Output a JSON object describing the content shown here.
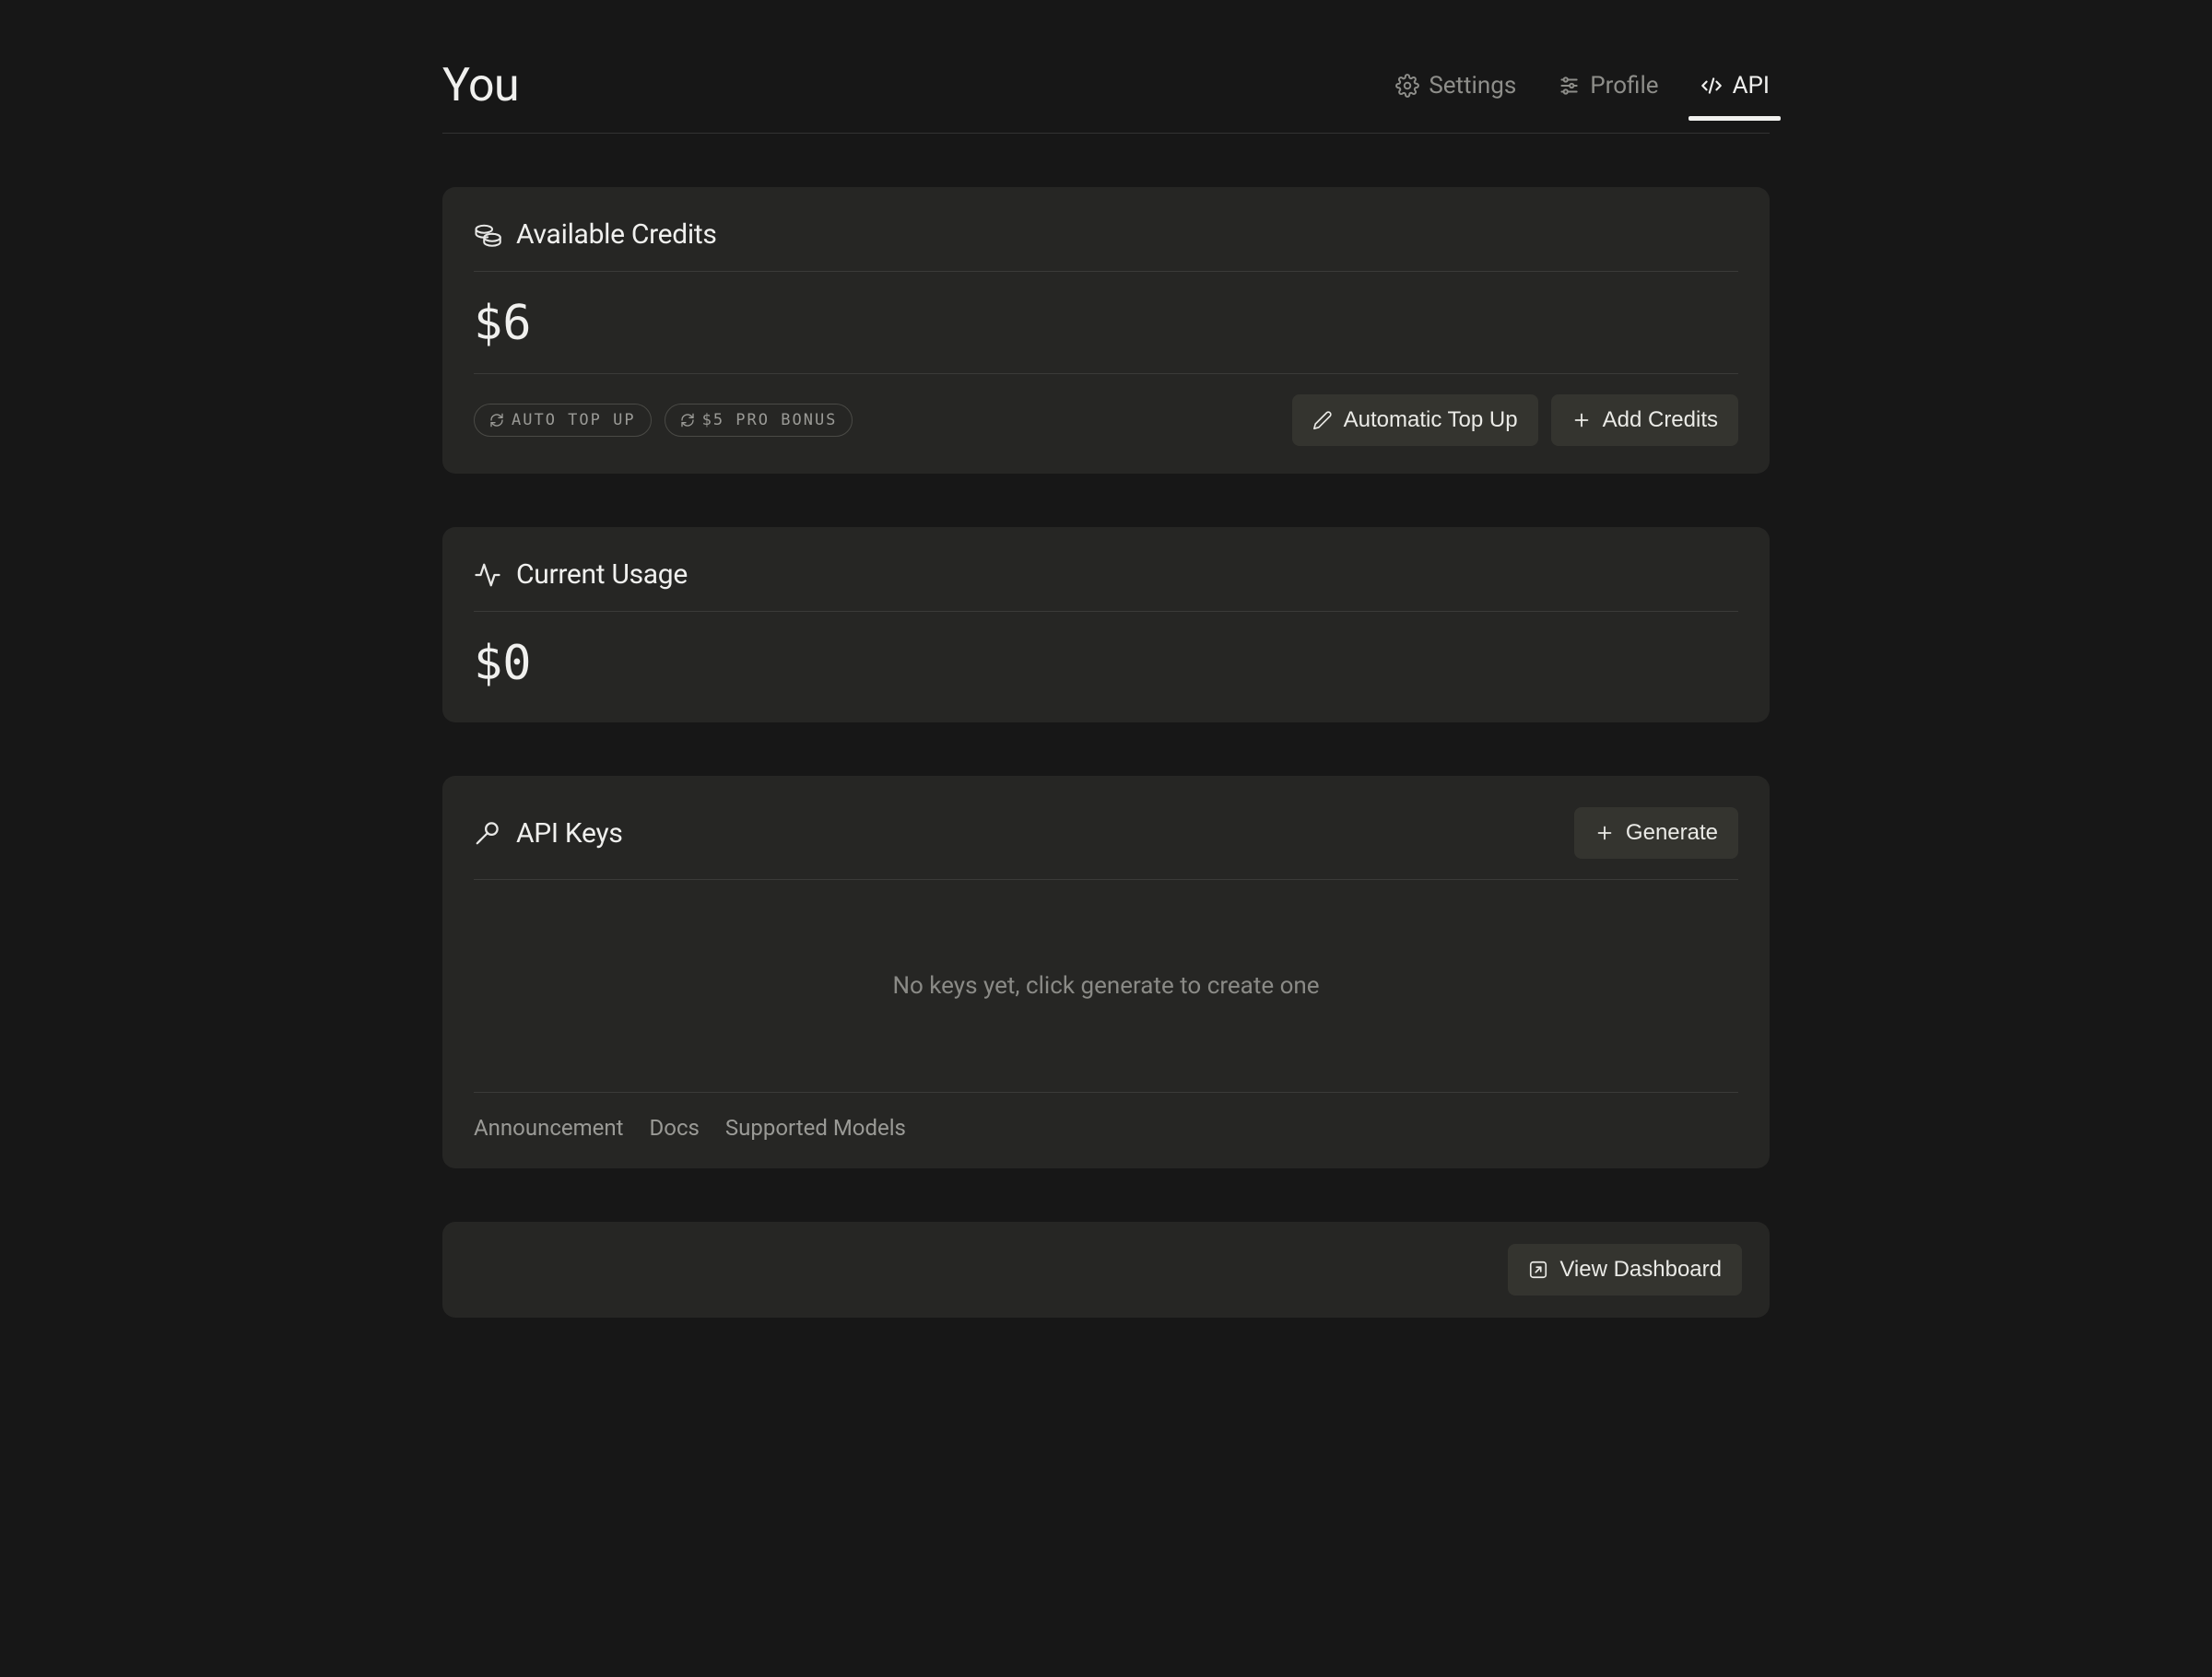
{
  "page": {
    "title": "You"
  },
  "tabs": {
    "settings": "Settings",
    "profile": "Profile",
    "api": "API"
  },
  "credits": {
    "title": "Available Credits",
    "value": "$6",
    "chip_auto": "AUTO TOP UP",
    "chip_bonus": "$5 PRO BONUS",
    "btn_auto": "Automatic Top Up",
    "btn_add": "Add Credits"
  },
  "usage": {
    "title": "Current Usage",
    "value": "$0"
  },
  "apikeys": {
    "title": "API Keys",
    "btn_generate": "Generate",
    "empty": "No keys yet, click generate to create one",
    "links": {
      "announcement": "Announcement",
      "docs": "Docs",
      "models": "Supported Models"
    }
  },
  "dashboard": {
    "btn": "View Dashboard"
  }
}
